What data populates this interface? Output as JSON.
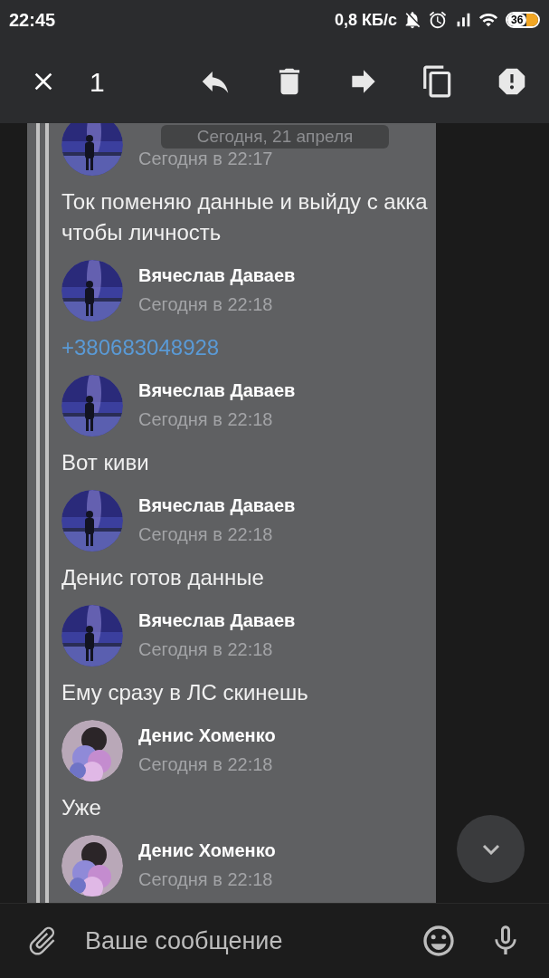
{
  "status_bar": {
    "time": "22:45",
    "speed": "0,8 КБ/с",
    "battery": "36"
  },
  "action_bar": {
    "selected_count": "1"
  },
  "date_pill": "Сегодня, 21 апреля",
  "messages": [
    {
      "kind": "header",
      "time": "Сегодня в 22:17",
      "avatar": {
        "kind": "night"
      }
    },
    {
      "kind": "text",
      "text": "Ток поменяю данные и выйду с акка чтобы личность"
    },
    {
      "kind": "header",
      "author": "Вячеслав Даваев",
      "time": "Сегодня в 22:18",
      "avatar": {
        "kind": "night"
      }
    },
    {
      "kind": "link",
      "text": "+380683048928"
    },
    {
      "kind": "header",
      "author": "Вячеслав Даваев",
      "time": "Сегодня в 22:18",
      "avatar": {
        "kind": "night"
      }
    },
    {
      "kind": "text",
      "text": "Вот киви"
    },
    {
      "kind": "header",
      "author": "Вячеслав Даваев",
      "time": "Сегодня в 22:18",
      "avatar": {
        "kind": "night"
      }
    },
    {
      "kind": "text",
      "text": "Денис готов данные"
    },
    {
      "kind": "header",
      "author": "Вячеслав Даваев",
      "time": "Сегодня в 22:18",
      "avatar": {
        "kind": "night"
      }
    },
    {
      "kind": "text",
      "text": "Ему сразу в ЛС скинешь"
    },
    {
      "kind": "header",
      "author": "Денис Хоменко",
      "time": "Сегодня в 22:18",
      "avatar": {
        "kind": "smoke"
      }
    },
    {
      "kind": "text",
      "text": "Уже"
    },
    {
      "kind": "header",
      "author": "Денис Хоменко",
      "time": "Сегодня в 22:18",
      "avatar": {
        "kind": "smoke"
      }
    }
  ],
  "composer": {
    "placeholder": "Ваше сообщение"
  }
}
